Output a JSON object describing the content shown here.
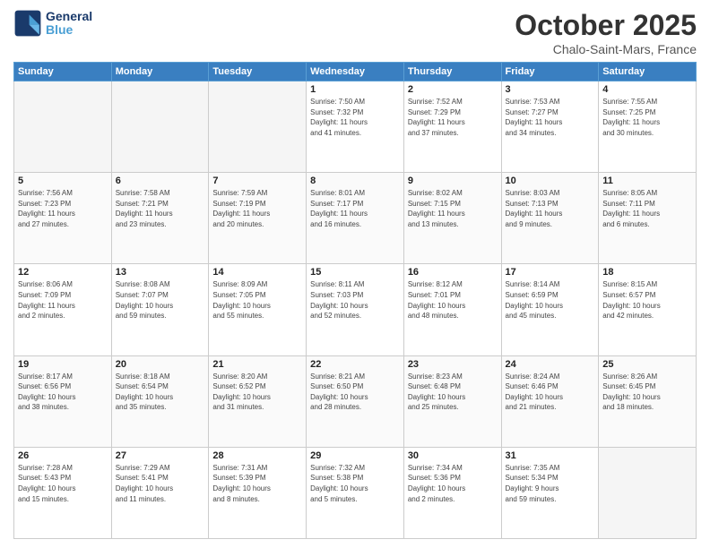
{
  "header": {
    "logo_line1": "General",
    "logo_line2": "Blue",
    "month": "October 2025",
    "location": "Chalo-Saint-Mars, France"
  },
  "weekdays": [
    "Sunday",
    "Monday",
    "Tuesday",
    "Wednesday",
    "Thursday",
    "Friday",
    "Saturday"
  ],
  "weeks": [
    [
      {
        "day": "",
        "info": ""
      },
      {
        "day": "",
        "info": ""
      },
      {
        "day": "",
        "info": ""
      },
      {
        "day": "1",
        "info": "Sunrise: 7:50 AM\nSunset: 7:32 PM\nDaylight: 11 hours\nand 41 minutes."
      },
      {
        "day": "2",
        "info": "Sunrise: 7:52 AM\nSunset: 7:29 PM\nDaylight: 11 hours\nand 37 minutes."
      },
      {
        "day": "3",
        "info": "Sunrise: 7:53 AM\nSunset: 7:27 PM\nDaylight: 11 hours\nand 34 minutes."
      },
      {
        "day": "4",
        "info": "Sunrise: 7:55 AM\nSunset: 7:25 PM\nDaylight: 11 hours\nand 30 minutes."
      }
    ],
    [
      {
        "day": "5",
        "info": "Sunrise: 7:56 AM\nSunset: 7:23 PM\nDaylight: 11 hours\nand 27 minutes."
      },
      {
        "day": "6",
        "info": "Sunrise: 7:58 AM\nSunset: 7:21 PM\nDaylight: 11 hours\nand 23 minutes."
      },
      {
        "day": "7",
        "info": "Sunrise: 7:59 AM\nSunset: 7:19 PM\nDaylight: 11 hours\nand 20 minutes."
      },
      {
        "day": "8",
        "info": "Sunrise: 8:01 AM\nSunset: 7:17 PM\nDaylight: 11 hours\nand 16 minutes."
      },
      {
        "day": "9",
        "info": "Sunrise: 8:02 AM\nSunset: 7:15 PM\nDaylight: 11 hours\nand 13 minutes."
      },
      {
        "day": "10",
        "info": "Sunrise: 8:03 AM\nSunset: 7:13 PM\nDaylight: 11 hours\nand 9 minutes."
      },
      {
        "day": "11",
        "info": "Sunrise: 8:05 AM\nSunset: 7:11 PM\nDaylight: 11 hours\nand 6 minutes."
      }
    ],
    [
      {
        "day": "12",
        "info": "Sunrise: 8:06 AM\nSunset: 7:09 PM\nDaylight: 11 hours\nand 2 minutes."
      },
      {
        "day": "13",
        "info": "Sunrise: 8:08 AM\nSunset: 7:07 PM\nDaylight: 10 hours\nand 59 minutes."
      },
      {
        "day": "14",
        "info": "Sunrise: 8:09 AM\nSunset: 7:05 PM\nDaylight: 10 hours\nand 55 minutes."
      },
      {
        "day": "15",
        "info": "Sunrise: 8:11 AM\nSunset: 7:03 PM\nDaylight: 10 hours\nand 52 minutes."
      },
      {
        "day": "16",
        "info": "Sunrise: 8:12 AM\nSunset: 7:01 PM\nDaylight: 10 hours\nand 48 minutes."
      },
      {
        "day": "17",
        "info": "Sunrise: 8:14 AM\nSunset: 6:59 PM\nDaylight: 10 hours\nand 45 minutes."
      },
      {
        "day": "18",
        "info": "Sunrise: 8:15 AM\nSunset: 6:57 PM\nDaylight: 10 hours\nand 42 minutes."
      }
    ],
    [
      {
        "day": "19",
        "info": "Sunrise: 8:17 AM\nSunset: 6:56 PM\nDaylight: 10 hours\nand 38 minutes."
      },
      {
        "day": "20",
        "info": "Sunrise: 8:18 AM\nSunset: 6:54 PM\nDaylight: 10 hours\nand 35 minutes."
      },
      {
        "day": "21",
        "info": "Sunrise: 8:20 AM\nSunset: 6:52 PM\nDaylight: 10 hours\nand 31 minutes."
      },
      {
        "day": "22",
        "info": "Sunrise: 8:21 AM\nSunset: 6:50 PM\nDaylight: 10 hours\nand 28 minutes."
      },
      {
        "day": "23",
        "info": "Sunrise: 8:23 AM\nSunset: 6:48 PM\nDaylight: 10 hours\nand 25 minutes."
      },
      {
        "day": "24",
        "info": "Sunrise: 8:24 AM\nSunset: 6:46 PM\nDaylight: 10 hours\nand 21 minutes."
      },
      {
        "day": "25",
        "info": "Sunrise: 8:26 AM\nSunset: 6:45 PM\nDaylight: 10 hours\nand 18 minutes."
      }
    ],
    [
      {
        "day": "26",
        "info": "Sunrise: 7:28 AM\nSunset: 5:43 PM\nDaylight: 10 hours\nand 15 minutes."
      },
      {
        "day": "27",
        "info": "Sunrise: 7:29 AM\nSunset: 5:41 PM\nDaylight: 10 hours\nand 11 minutes."
      },
      {
        "day": "28",
        "info": "Sunrise: 7:31 AM\nSunset: 5:39 PM\nDaylight: 10 hours\nand 8 minutes."
      },
      {
        "day": "29",
        "info": "Sunrise: 7:32 AM\nSunset: 5:38 PM\nDaylight: 10 hours\nand 5 minutes."
      },
      {
        "day": "30",
        "info": "Sunrise: 7:34 AM\nSunset: 5:36 PM\nDaylight: 10 hours\nand 2 minutes."
      },
      {
        "day": "31",
        "info": "Sunrise: 7:35 AM\nSunset: 5:34 PM\nDaylight: 9 hours\nand 59 minutes."
      },
      {
        "day": "",
        "info": ""
      }
    ]
  ]
}
